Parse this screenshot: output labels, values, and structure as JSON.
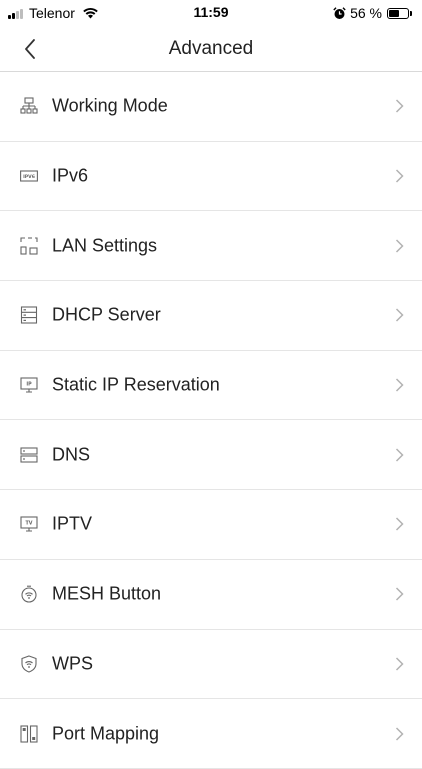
{
  "status_bar": {
    "carrier": "Telenor",
    "time": "11:59",
    "battery_percent": "56 %",
    "battery_level": 0.56
  },
  "header": {
    "title": "Advanced"
  },
  "menu": [
    {
      "label": "Working Mode",
      "icon": "network-topology-icon"
    },
    {
      "label": "IPv6",
      "icon": "ipv6-icon",
      "icon_text": "IPV6"
    },
    {
      "label": "LAN Settings",
      "icon": "lan-settings-icon"
    },
    {
      "label": "DHCP Server",
      "icon": "server-icon"
    },
    {
      "label": "Static IP Reservation",
      "icon": "ip-monitor-icon",
      "icon_text": "IP"
    },
    {
      "label": "DNS",
      "icon": "dns-server-icon"
    },
    {
      "label": "IPTV",
      "icon": "tv-icon",
      "icon_text": "TV"
    },
    {
      "label": "MESH Button",
      "icon": "mesh-button-icon"
    },
    {
      "label": "WPS",
      "icon": "wps-shield-icon"
    },
    {
      "label": "Port Mapping",
      "icon": "port-mapping-icon"
    }
  ]
}
